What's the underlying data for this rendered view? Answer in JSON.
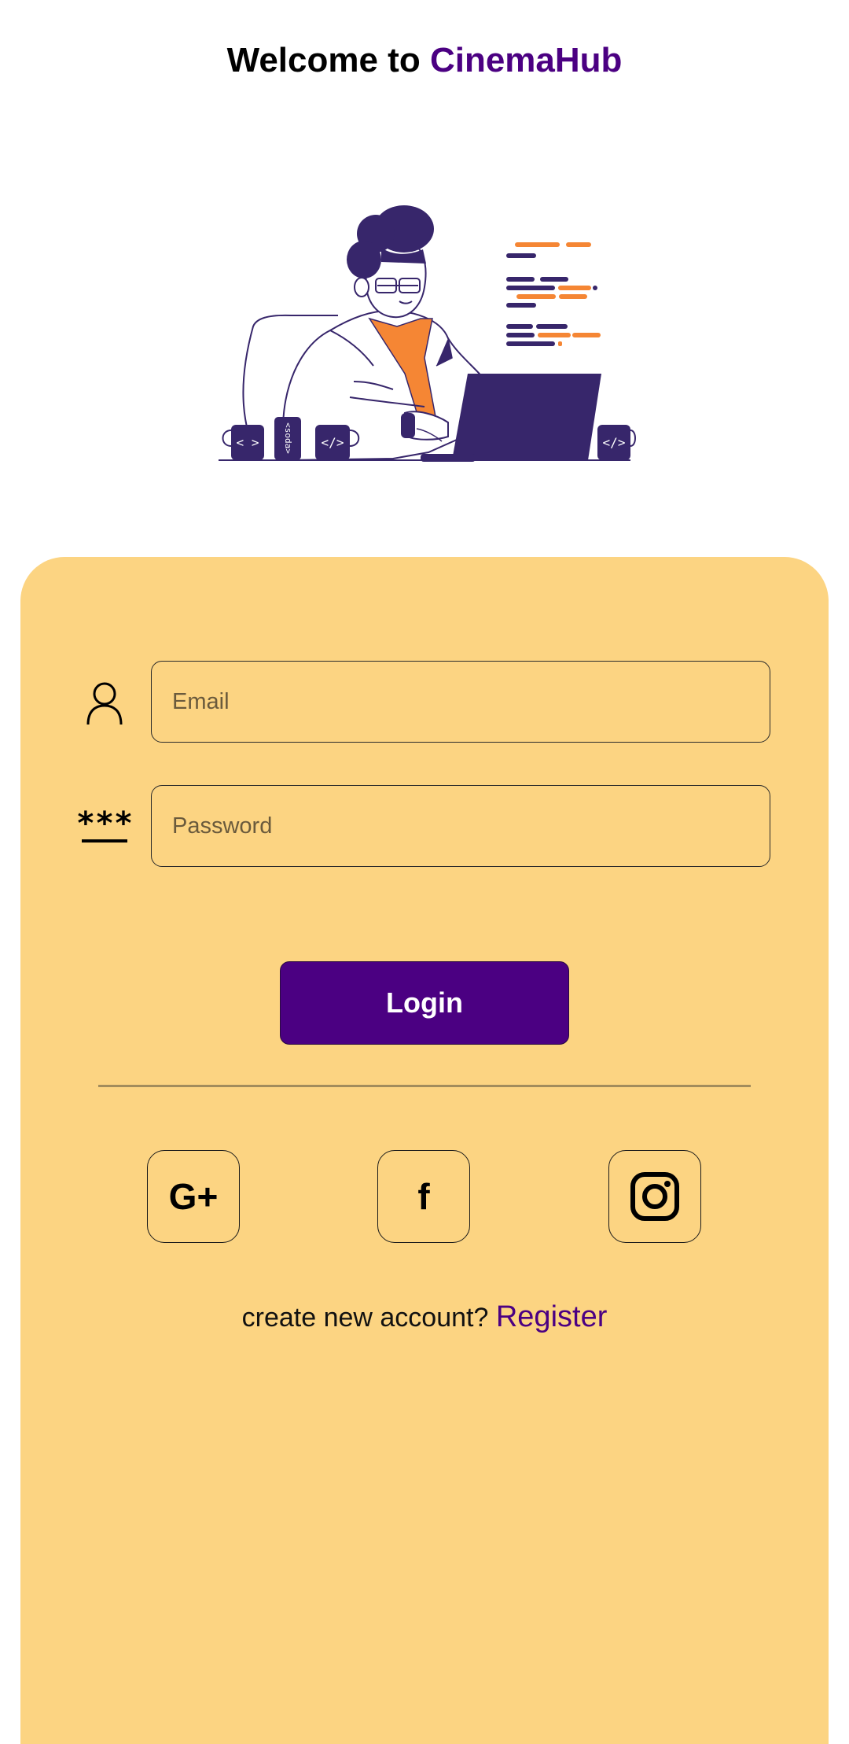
{
  "header": {
    "title_prefix": "Welcome to",
    "title_brand": "CinemaHub"
  },
  "illustration": {
    "cup_labels": [
      "< >",
      "</>",
      "</>"
    ],
    "can_label": "<soda>"
  },
  "form": {
    "email_placeholder": "Email",
    "password_placeholder": "Password",
    "password_icon_text": "***",
    "login_label": "Login"
  },
  "social": {
    "google_label": "G+",
    "facebook_label": "f",
    "instagram_icon": "instagram-icon"
  },
  "register": {
    "prompt": "create new account?",
    "link_label": "Register"
  },
  "colors": {
    "brand": "#4b0082",
    "card": "#fcd482",
    "accent_orange": "#f58634",
    "illustration_navy": "#37266b"
  }
}
